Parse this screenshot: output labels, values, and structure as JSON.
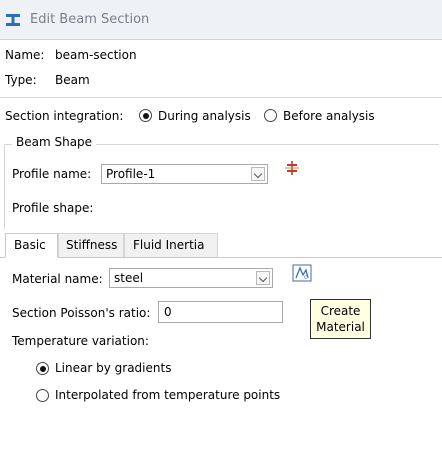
{
  "window": {
    "title": "Edit Beam Section",
    "icon": "beam-section-icon"
  },
  "info": {
    "name_label": "Name:",
    "name_value": "beam-section",
    "type_label": "Type:",
    "type_value": "Beam"
  },
  "section_integration": {
    "label": "Section integration:",
    "options": [
      "During analysis",
      "Before analysis"
    ],
    "selected": "During analysis"
  },
  "beam_shape": {
    "group_title": "Beam Shape",
    "profile_name_label": "Profile name:",
    "profile_name_value": "Profile-1",
    "profile_shape_label": "Profile shape:",
    "profile_icon": "crosshair-icon"
  },
  "tabs": [
    {
      "label": "Basic",
      "active": true
    },
    {
      "label": "Stiffness",
      "active": false
    },
    {
      "label": "Fluid Inertia",
      "active": false
    }
  ],
  "basic": {
    "material_name_label": "Material name:",
    "material_name_value": "steel",
    "create_material_icon": "create-material-icon",
    "poisson_label": "Section Poisson's ratio:",
    "poisson_value": "0",
    "temperature_label": "Temperature variation:",
    "temperature_options": [
      "Linear by gradients",
      "Interpolated from temperature points"
    ],
    "temperature_selected": "Linear by gradients"
  },
  "tooltip": {
    "text_line1": "Create",
    "text_line2": "Material"
  },
  "colors": {
    "titlebar": "#eef1f6",
    "tooltip_bg": "#ffffe1",
    "icon_accent": "#c0392b"
  }
}
